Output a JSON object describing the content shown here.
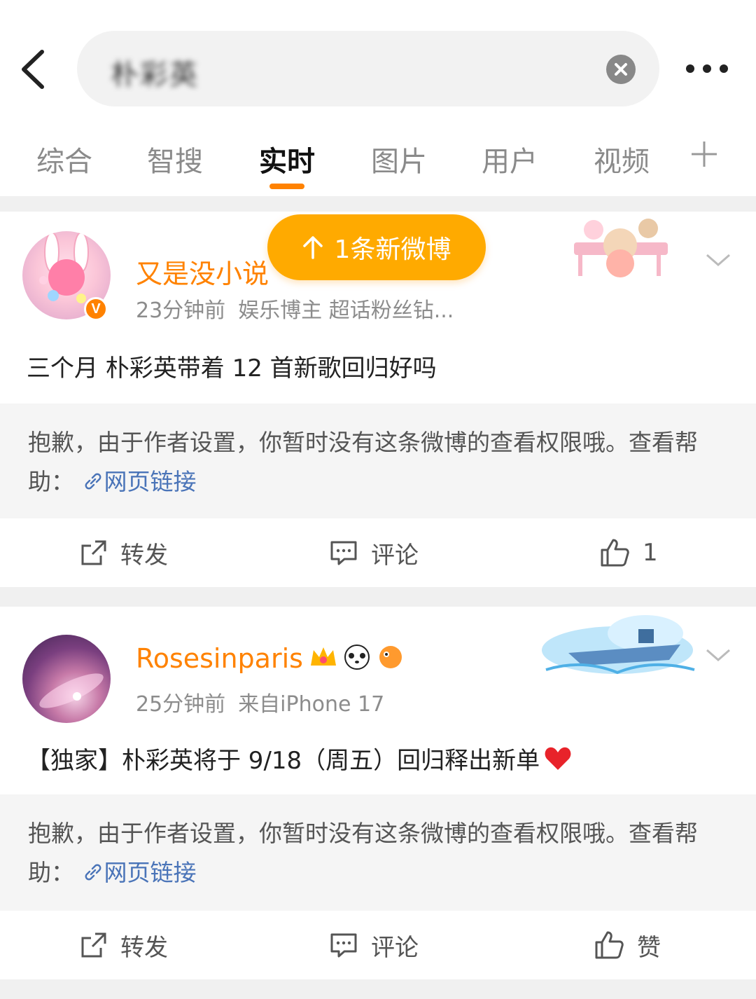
{
  "search": {
    "query": "朴彩英"
  },
  "tabs": [
    {
      "label": "综合"
    },
    {
      "label": "智搜"
    },
    {
      "label": "实时"
    },
    {
      "label": "图片"
    },
    {
      "label": "用户"
    },
    {
      "label": "视频"
    }
  ],
  "new_posts_pill": {
    "label": "1条新微博"
  },
  "posts": [
    {
      "username": "又是没小说",
      "time": "23分钟前",
      "tags": "娱乐博主 超话粉丝钻...",
      "verified": "V",
      "text": "三个月 朴彩英带着 12 首新歌回归好吗",
      "notice": "抱歉，由于作者设置，你暂时没有这条微博的查看权限哦。查看帮助：",
      "link": "网页链接",
      "repost": "转发",
      "comment": "评论",
      "like": "1"
    },
    {
      "username": "Rosesinparis",
      "time": "25分钟前",
      "source": "来自iPhone 17",
      "text": "【独家】朴彩英将于 9/18（周五）回归释出新单",
      "notice": "抱歉，由于作者设置，你暂时没有这条微博的查看权限哦。查看帮助：",
      "link": "网页链接",
      "repost": "转发",
      "comment": "评论",
      "like": "赞"
    }
  ],
  "colors": {
    "accent": "#ff8200",
    "link": "#4a74b8",
    "pill": "#ffaa00",
    "notice_bg": "#f5f5f5"
  }
}
